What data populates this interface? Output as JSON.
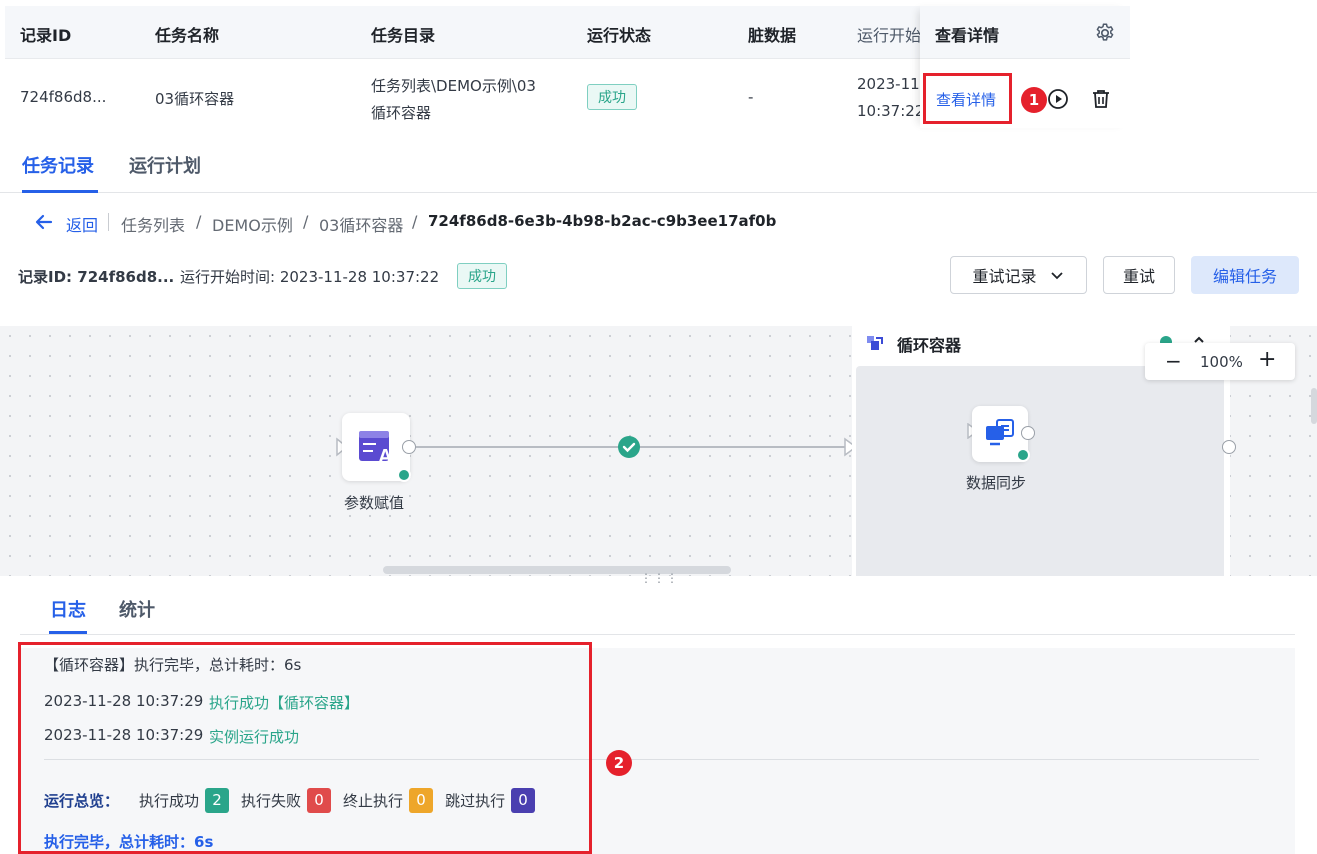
{
  "table": {
    "headers": [
      "记录ID",
      "任务名称",
      "任务目录",
      "运行状态",
      "脏数据",
      "运行开始",
      "查看详情"
    ],
    "row": {
      "record_id": "724f86d8...",
      "task_name": "03循环容器",
      "task_dir_line1": "任务列表\\DEMO示例\\03",
      "task_dir_line2": "循环容器",
      "status": "成功",
      "dirty": "-",
      "start_line1": "2023-11-",
      "start_line2": "10:37:22",
      "detail_link": "查看详情"
    }
  },
  "annotations": {
    "marker1": "1",
    "marker2": "2"
  },
  "tabs": [
    "任务记录",
    "运行计划"
  ],
  "breadcrumb": {
    "back": "返回",
    "items": [
      "任务列表",
      "DEMO示例",
      "03循环容器"
    ],
    "current": "724f86d8-6e3b-4b98-b2ac-c9b3ee17af0b",
    "sep": "/"
  },
  "info": {
    "record_label": "记录ID: 724f86d8...",
    "start_time": "运行开始时间: 2023-11-28 10:37:22",
    "status": "成功",
    "retry_records": "重试记录",
    "retry": "重试",
    "edit_task": "编辑任务"
  },
  "canvas": {
    "node1_label": "参数赋值",
    "container_title": "循环容器",
    "node2_label": "数据同步",
    "zoom": "100%",
    "zoom_out": "−",
    "zoom_in": "+"
  },
  "log_tabs": [
    "日志",
    "统计"
  ],
  "log": {
    "line1": "【循环容器】执行完毕，总计耗时：6s",
    "line2_time": "2023-11-28 10:37:29",
    "line2_msg": "执行成功【循环容器】",
    "line3_time": "2023-11-28 10:37:29",
    "line3_msg": "实例运行成功",
    "overview_label": "运行总览：",
    "success_label": "执行成功",
    "success_count": "2",
    "fail_label": "执行失败",
    "fail_count": "0",
    "stop_label": "终止执行",
    "stop_count": "0",
    "skip_label": "跳过执行",
    "skip_count": "0",
    "summary": "执行完毕，总计耗时：6s"
  },
  "colors": {
    "accent": "#2660e8",
    "success": "#2aa58a",
    "fail": "#e04b4b",
    "stop": "#eea62a",
    "skip": "#4a3fb0",
    "annotation": "#e5212c"
  }
}
